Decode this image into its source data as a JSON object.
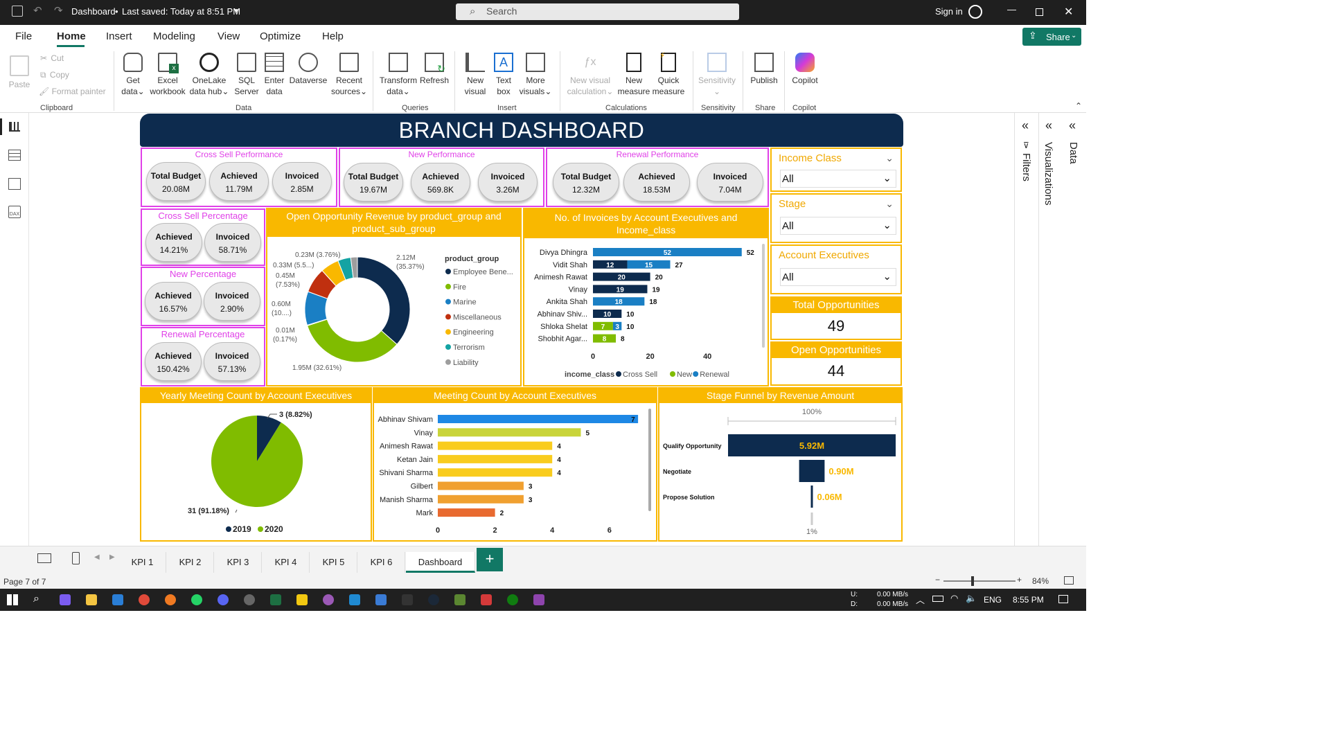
{
  "titlebar": {
    "title": "Dashboard",
    "saved": "Last saved: Today at 8:51 PM",
    "search_placeholder": "Search",
    "sign_in": "Sign in"
  },
  "menu": {
    "items": [
      "File",
      "Home",
      "Insert",
      "Modeling",
      "View",
      "Optimize",
      "Help"
    ],
    "share": "Share"
  },
  "ribbon": {
    "clipboard": {
      "paste": "Paste",
      "cut": "Cut",
      "copy": "Copy",
      "format_painter": "Format painter",
      "group": "Clipboard"
    },
    "data": {
      "items": [
        [
          "Get",
          "data"
        ],
        [
          "Excel",
          "workbook"
        ],
        [
          "OneLake",
          "data hub"
        ],
        [
          "SQL",
          "Server"
        ],
        [
          "Enter",
          "data"
        ],
        [
          "Dataverse",
          ""
        ],
        [
          "Recent",
          "sources"
        ]
      ],
      "group": "Data"
    },
    "queries": {
      "items": [
        [
          "Transform",
          "data"
        ],
        [
          "Refresh",
          ""
        ]
      ],
      "group": "Queries"
    },
    "insert": {
      "items": [
        [
          "New",
          "visual"
        ],
        [
          "Text",
          "box"
        ],
        [
          "More",
          "visuals"
        ]
      ],
      "group": "Insert"
    },
    "calculations": {
      "items": [
        [
          "New visual",
          "calculation"
        ],
        [
          "New",
          "measure"
        ],
        [
          "Quick",
          "measure"
        ]
      ],
      "group": "Calculations"
    },
    "sensitivity": {
      "label": "Sensitivity",
      "group": "Sensitivity"
    },
    "share": {
      "label": "Publish",
      "group": "Share"
    },
    "copilot": {
      "label": "Copilot",
      "group": "Copilot"
    }
  },
  "panes": {
    "filters": "Filters",
    "visualizations": "Visualizations",
    "data": "Data"
  },
  "dashboard": {
    "title": "BRANCH DASHBOARD",
    "kpis": [
      {
        "title": "Cross Sell Performance",
        "items": [
          {
            "label": "Total Budget",
            "value": "20.08M"
          },
          {
            "label": "Achieved",
            "value": "11.79M"
          },
          {
            "label": "Invoiced",
            "value": "2.85M"
          }
        ]
      },
      {
        "title": "New Performance",
        "items": [
          {
            "label": "Total Budget",
            "value": "19.67M"
          },
          {
            "label": "Achieved",
            "value": "569.8K"
          },
          {
            "label": "Invoiced",
            "value": "3.26M"
          }
        ]
      },
      {
        "title": "Renewal Performance",
        "items": [
          {
            "label": "Total Budget",
            "value": "12.32M"
          },
          {
            "label": "Achieved",
            "value": "18.53M"
          },
          {
            "label": "Invoiced",
            "value": "7.04M"
          }
        ]
      }
    ],
    "percentages": [
      {
        "title": "Cross Sell Percentage",
        "items": [
          {
            "label": "Achieved",
            "value": "14.21%"
          },
          {
            "label": "Invoiced",
            "value": "58.71%"
          }
        ]
      },
      {
        "title": "New Percentage",
        "items": [
          {
            "label": "Achieved",
            "value": "16.57%"
          },
          {
            "label": "Invoiced",
            "value": "2.90%"
          }
        ]
      },
      {
        "title": "Renewal Percentage",
        "items": [
          {
            "label": "Achieved",
            "value": "150.42%"
          },
          {
            "label": "Invoiced",
            "value": "57.13%"
          }
        ]
      }
    ],
    "slicers": [
      {
        "label": "Income Class",
        "value": "All"
      },
      {
        "label": "Stage",
        "value": "All"
      },
      {
        "label": "Account Executives",
        "value": "All"
      }
    ],
    "cards": [
      {
        "label": "Total Opportunities",
        "value": "49"
      },
      {
        "label": "Open Opportunities",
        "value": "44"
      }
    ]
  },
  "colors": {
    "navy": "#0d2b4e",
    "gold": "#f9b800",
    "magenta": "#e040e8",
    "green": "#80bc00",
    "blue": "#1e88e5"
  },
  "chart_data": [
    {
      "type": "donut",
      "title": "Open Opportunity Revenue by product_group and product_sub_group",
      "legend_title": "product_group",
      "legend": [
        "Employee Bene...",
        "Fire",
        "Marine",
        "Miscellaneous",
        "Engineering",
        "Terrorism",
        "Liability"
      ],
      "slices": [
        {
          "value": 2.12,
          "label": "2.12M",
          "pct": "(35.37%)",
          "color": "#0d2b4e"
        },
        {
          "value": 1.95,
          "label": "1.95M (32.61%)",
          "pct": "",
          "color": "#80bc00"
        },
        {
          "value": 0.01,
          "label": "0.01M",
          "pct": "(0.17%)",
          "color": "#1a7fc4"
        },
        {
          "value": 0.6,
          "label": "0.60M",
          "pct": "(10....)",
          "color": "#1a7fc4"
        },
        {
          "value": 0.45,
          "label": "0.45M",
          "pct": "(7.53%)",
          "color": "#c0300f"
        },
        {
          "value": 0.33,
          "label": "0.33M (5.5...)",
          "pct": "",
          "color": "#f9b800"
        },
        {
          "value": 0.23,
          "label": "0.23M (3.76%)",
          "pct": "",
          "color": "#14a3a3"
        },
        {
          "value": 0.12,
          "label": "",
          "pct": "",
          "color": "#9e9e9e"
        }
      ]
    },
    {
      "type": "bar",
      "title": "No. of Invoices by Account Executives and Income_class",
      "legend_title": "income_class",
      "categories": [
        "Divya Dhingra",
        "Vidit Shah",
        "Animesh Rawat",
        "Vinay",
        "Ankita Shah",
        "Abhinav Shiv...",
        "Shloka Shelat",
        "Shobhit Agar..."
      ],
      "series": [
        {
          "name": "Cross Sell",
          "color": "#0d2b4e",
          "values": [
            0,
            12,
            20,
            19,
            0,
            10,
            0,
            0
          ]
        },
        {
          "name": "New",
          "color": "#80bc00",
          "values": [
            0,
            0,
            0,
            0,
            0,
            0,
            7,
            8
          ]
        },
        {
          "name": "Renewal",
          "color": "#1a7fc4",
          "values": [
            52,
            15,
            0,
            0,
            18,
            0,
            3,
            0
          ]
        }
      ],
      "totals": [
        52,
        27,
        20,
        19,
        18,
        10,
        10,
        8
      ],
      "xticks": [
        0,
        20,
        40
      ],
      "xlim": [
        0,
        60
      ]
    },
    {
      "type": "pie",
      "title": "Yearly Meeting Count by Account Executives",
      "slices": [
        {
          "name": "2019",
          "value": 3,
          "label": "3 (8.82%)",
          "color": "#0d2b4e"
        },
        {
          "name": "2020",
          "value": 31,
          "label": "31 (91.18%)",
          "color": "#80bc00"
        }
      ]
    },
    {
      "type": "bar",
      "title": "Meeting Count by Account Executives",
      "categories": [
        "Abhinav Shivam",
        "Vinay",
        "Animesh Rawat",
        "Ketan Jain",
        "Shivani Sharma",
        "Gilbert",
        "Manish Sharma",
        "Mark"
      ],
      "values": [
        7,
        5,
        4,
        4,
        4,
        3,
        3,
        2
      ],
      "colors": [
        "#1e88e5",
        "#c9d43a",
        "#f9cc1e",
        "#f9cc1e",
        "#f9cc1e",
        "#f0a030",
        "#f0a030",
        "#e86a30"
      ],
      "xticks": [
        0,
        2,
        4,
        6
      ],
      "xlim": [
        0,
        7
      ]
    },
    {
      "type": "funnel",
      "title": "Stage Funnel by Revenue Amount",
      "top_label": "100%",
      "bottom_label": "1%",
      "stages": [
        {
          "name": "Qualify Opportunity",
          "value": 5.92,
          "label": "5.92M"
        },
        {
          "name": "Negotiate",
          "value": 0.9,
          "label": "0.90M"
        },
        {
          "name": "Propose Solution",
          "value": 0.06,
          "label": "0.06M"
        }
      ]
    }
  ],
  "tabs": [
    "KPI 1",
    "KPI 2",
    "KPI 3",
    "KPI 4",
    "KPI 5",
    "KPI 6",
    "Dashboard"
  ],
  "status": {
    "page": "Page 7 of 7",
    "zoom": "84%"
  },
  "taskbar": {
    "net_up": "0.00 MB/s",
    "net_down": "0.00 MB/s",
    "up_label": "U:",
    "down_label": "D:",
    "lang": "ENG",
    "time": "8:55 PM"
  }
}
